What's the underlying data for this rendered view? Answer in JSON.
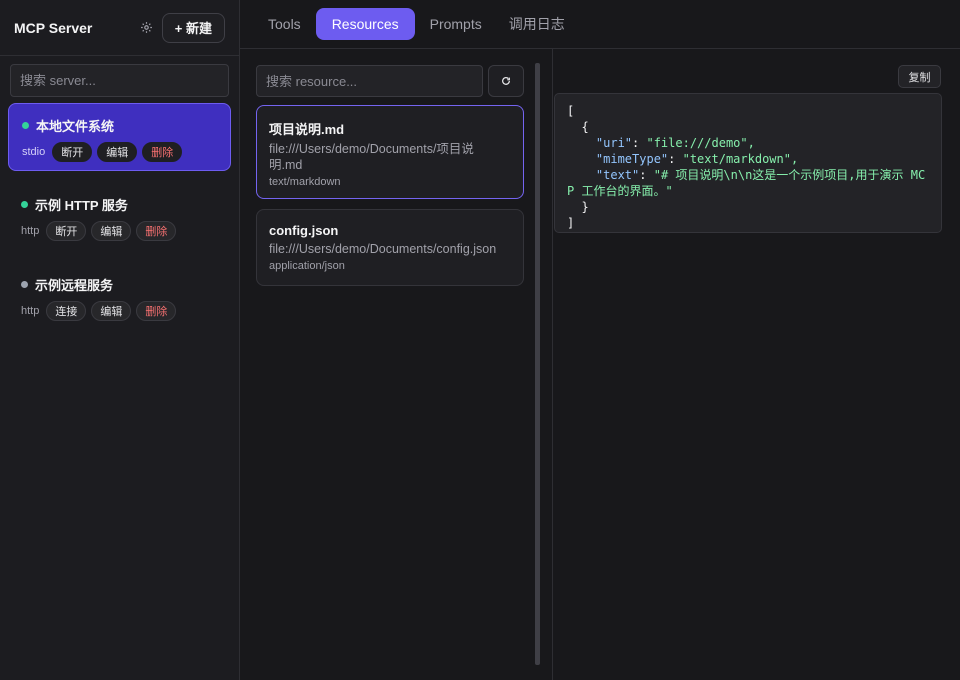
{
  "sidebar": {
    "title": "MCP Server",
    "new_label": "+ 新建",
    "search_placeholder": "搜索 server...",
    "servers": [
      {
        "name": "本地文件系统",
        "type": "stdio",
        "status": "connected",
        "actions": [
          "断开",
          "编辑",
          "删除"
        ]
      },
      {
        "name": "示例 HTTP 服务",
        "type": "http",
        "status": "connected",
        "actions": [
          "断开",
          "编辑",
          "删除"
        ]
      },
      {
        "name": "示例远程服务",
        "type": "http",
        "status": "disconnected",
        "actions": [
          "连接",
          "编辑",
          "删除"
        ]
      }
    ]
  },
  "tabs": [
    {
      "label": "Tools"
    },
    {
      "label": "Resources"
    },
    {
      "label": "Prompts"
    },
    {
      "label": "调用日志"
    }
  ],
  "resources": {
    "search_placeholder": "搜索 resource...",
    "items": [
      {
        "name": "项目说明.md",
        "uri_line1": "file:///Users/demo/Documents/项目说",
        "uri_line2": "明.md",
        "mime": "text/markdown"
      },
      {
        "name": "config.json",
        "uri_line1": "file:///Users/demo/Documents/config.json",
        "mime": "application/json"
      }
    ]
  },
  "detail": {
    "copy_label": "复制",
    "code": {
      "open_bracket": "[",
      "open_brace": "  {",
      "uri_key": "\"uri\"",
      "uri_val": "\"file:///demo\",",
      "mime_key": "\"mimeType\"",
      "mime_val": "\"text/markdown\",",
      "text_key": "\"text\"",
      "text_val_1": "\"# 项目说明\\n\\n这是一个示例项目,用于演示 MC",
      "text_val_2": "P 工作台的界面。\"",
      "close_brace": "  }",
      "close_bracket": "]"
    }
  },
  "colors": {
    "accent": "#6d5cf0",
    "active_server_bg": "#3f2fbf",
    "status_green": "#34d399",
    "danger": "#f87171"
  }
}
